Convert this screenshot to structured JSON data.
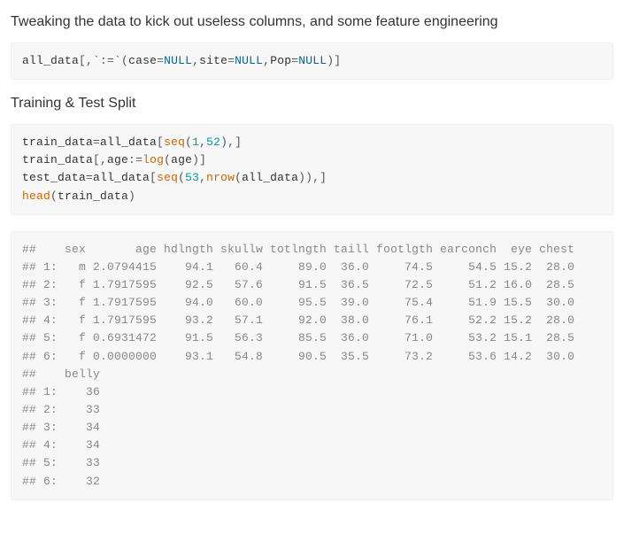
{
  "headings": {
    "tweak": "Tweaking the data to kick out useless columns, and some feature engineering",
    "split": "Training & Test Split"
  },
  "code1": {
    "tokens": [
      {
        "t": "all_data",
        "c": "tok-var"
      },
      {
        "t": "[,",
        "c": "tok-punc"
      },
      {
        "t": "`:=`",
        "c": "tok-op"
      },
      {
        "t": "(",
        "c": "tok-punc"
      },
      {
        "t": "case",
        "c": "tok-var"
      },
      {
        "t": "=",
        "c": "tok-op"
      },
      {
        "t": "NULL",
        "c": "tok-kw"
      },
      {
        "t": ",",
        "c": "tok-punc"
      },
      {
        "t": "site",
        "c": "tok-var"
      },
      {
        "t": "=",
        "c": "tok-op"
      },
      {
        "t": "NULL",
        "c": "tok-kw"
      },
      {
        "t": ",",
        "c": "tok-punc"
      },
      {
        "t": "Pop",
        "c": "tok-var"
      },
      {
        "t": "=",
        "c": "tok-op"
      },
      {
        "t": "NULL",
        "c": "tok-kw"
      },
      {
        "t": ")]",
        "c": "tok-punc"
      }
    ]
  },
  "code2": {
    "lines": [
      [
        {
          "t": "train_data",
          "c": "tok-var"
        },
        {
          "t": "=",
          "c": "tok-op"
        },
        {
          "t": "all_data",
          "c": "tok-var"
        },
        {
          "t": "[",
          "c": "tok-punc"
        },
        {
          "t": "seq",
          "c": "tok-fn"
        },
        {
          "t": "(",
          "c": "tok-punc"
        },
        {
          "t": "1",
          "c": "tok-num"
        },
        {
          "t": ",",
          "c": "tok-punc"
        },
        {
          "t": "52",
          "c": "tok-num"
        },
        {
          "t": "),]",
          "c": "tok-punc"
        }
      ],
      [
        {
          "t": "train_data",
          "c": "tok-var"
        },
        {
          "t": "[,",
          "c": "tok-punc"
        },
        {
          "t": "age",
          "c": "tok-var"
        },
        {
          "t": ":",
          "c": "tok-op"
        },
        {
          "t": "=",
          "c": "tok-op"
        },
        {
          "t": "log",
          "c": "tok-fn"
        },
        {
          "t": "(",
          "c": "tok-punc"
        },
        {
          "t": "age",
          "c": "tok-var"
        },
        {
          "t": ")]",
          "c": "tok-punc"
        }
      ],
      [
        {
          "t": "test_data",
          "c": "tok-var"
        },
        {
          "t": "=",
          "c": "tok-op"
        },
        {
          "t": "all_data",
          "c": "tok-var"
        },
        {
          "t": "[",
          "c": "tok-punc"
        },
        {
          "t": "seq",
          "c": "tok-fn"
        },
        {
          "t": "(",
          "c": "tok-punc"
        },
        {
          "t": "53",
          "c": "tok-num"
        },
        {
          "t": ",",
          "c": "tok-punc"
        },
        {
          "t": "nrow",
          "c": "tok-fn"
        },
        {
          "t": "(",
          "c": "tok-punc"
        },
        {
          "t": "all_data",
          "c": "tok-var"
        },
        {
          "t": ")),]",
          "c": "tok-punc"
        }
      ],
      [
        {
          "t": "head",
          "c": "tok-fn"
        },
        {
          "t": "(",
          "c": "tok-punc"
        },
        {
          "t": "train_data",
          "c": "tok-var"
        },
        {
          "t": ")",
          "c": "tok-punc"
        }
      ]
    ]
  },
  "output": {
    "lines": [
      "##    sex       age hdlngth skullw totlngth taill footlgth earconch  eye chest",
      "## 1:   m 2.0794415    94.1   60.4     89.0  36.0     74.5     54.5 15.2  28.0",
      "## 2:   f 1.7917595    92.5   57.6     91.5  36.5     72.5     51.2 16.0  28.5",
      "## 3:   f 1.7917595    94.0   60.0     95.5  39.0     75.4     51.9 15.5  30.0",
      "## 4:   f 1.7917595    93.2   57.1     92.0  38.0     76.1     52.2 15.2  28.0",
      "## 5:   f 0.6931472    91.5   56.3     85.5  36.0     71.0     53.2 15.1  28.5",
      "## 6:   f 0.0000000    93.1   54.8     90.5  35.5     73.2     53.6 14.2  30.0",
      "##    belly",
      "## 1:    36",
      "## 2:    33",
      "## 3:    34",
      "## 4:    34",
      "## 5:    33",
      "## 6:    32"
    ]
  }
}
